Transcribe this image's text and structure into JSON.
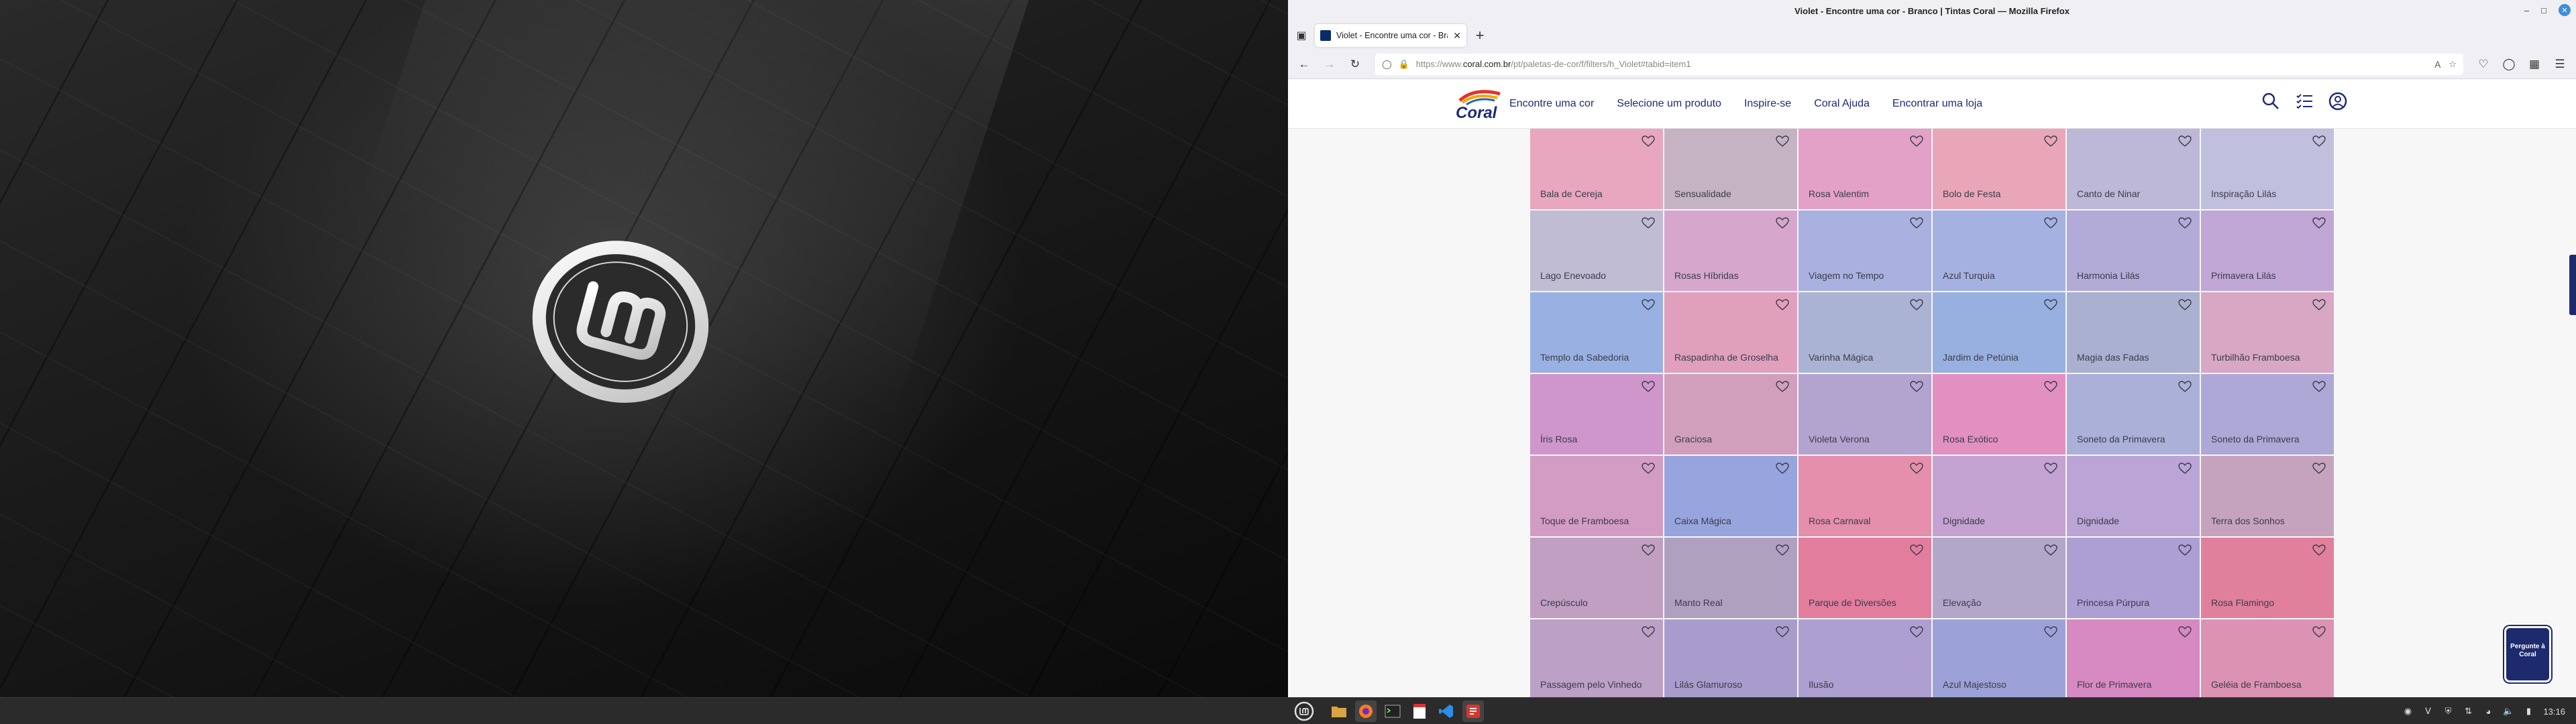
{
  "window": {
    "title": "Violet - Encontre uma cor - Branco | Tintas Coral — Mozilla Firefox"
  },
  "tab": {
    "label": "Violet - Encontre uma cor - Bran"
  },
  "urlbar": {
    "prefix": "https://www.",
    "domain": "coral.com.br",
    "path": "/pt/paletas-de-cor/f/filters/h_Violet#tabid=item1"
  },
  "site": {
    "logo_text": "Coral",
    "nav": [
      "Encontre uma cor",
      "Selecione um produto",
      "Inspire-se",
      "Coral Ajuda",
      "Encontrar uma loja"
    ]
  },
  "swatches": [
    {
      "name": "Bala de Cereja",
      "color": "#e8a7bf"
    },
    {
      "name": "Sensualidade",
      "color": "#c5b3c4"
    },
    {
      "name": "Rosa Valentim",
      "color": "#e3a1c7"
    },
    {
      "name": "Bolo de Festa",
      "color": "#eaa6b9"
    },
    {
      "name": "Canto de Ninar",
      "color": "#bdb7d8"
    },
    {
      "name": "Inspiração Lilás",
      "color": "#c1bfde"
    },
    {
      "name": "Lago Enevoado",
      "color": "#c0bcd4"
    },
    {
      "name": "Rosas Híbridas",
      "color": "#d6a6cd"
    },
    {
      "name": "Viagem no Tempo",
      "color": "#a8b1df"
    },
    {
      "name": "Azul Turquia",
      "color": "#a5b2e1"
    },
    {
      "name": "Harmonia Lilás",
      "color": "#b2aad7"
    },
    {
      "name": "Primavera Lilás",
      "color": "#c0a7d5"
    },
    {
      "name": "Templo da Sabedoria",
      "color": "#99b1e2"
    },
    {
      "name": "Raspadinha de Groselha",
      "color": "#e0a0bc"
    },
    {
      "name": "Varinha Mágica",
      "color": "#aab3d3"
    },
    {
      "name": "Jardim de Petúnia",
      "color": "#98b0e0"
    },
    {
      "name": "Magia das Fadas",
      "color": "#aab0d0"
    },
    {
      "name": "Turbilhão Framboesa",
      "color": "#d7a7c4"
    },
    {
      "name": "Íris Rosa",
      "color": "#cf96cb"
    },
    {
      "name": "Graciosa",
      "color": "#d19fbc"
    },
    {
      "name": "Violeta Verona",
      "color": "#b2a3cf"
    },
    {
      "name": "Rosa Exótico",
      "color": "#e290c2"
    },
    {
      "name": "Soneto da Primavera",
      "color": "#aab0d8"
    },
    {
      "name": "Soneto da Primavera",
      "color": "#aea8d6"
    },
    {
      "name": "Toque de Framboesa",
      "color": "#d39cc4"
    },
    {
      "name": "Caixa Mágica",
      "color": "#97a4dd"
    },
    {
      "name": "Rosa Carnaval",
      "color": "#e58fac"
    },
    {
      "name": "Dignidade",
      "color": "#c4a2d1"
    },
    {
      "name": "Dignidade",
      "color": "#bba4d6"
    },
    {
      "name": "Terra dos Sonhos",
      "color": "#c6a3bd"
    },
    {
      "name": "Crepúsculo",
      "color": "#c09fc3"
    },
    {
      "name": "Manto Real",
      "color": "#b0a0c0"
    },
    {
      "name": "Parque de Diversões",
      "color": "#e27d9e"
    },
    {
      "name": "Elevação",
      "color": "#b2a6c9"
    },
    {
      "name": "Princesa Púrpura",
      "color": "#ad9fd3"
    },
    {
      "name": "Rosa Flamingo",
      "color": "#e0809c"
    },
    {
      "name": "Passagem pelo Vinhedo",
      "color": "#bda0c5"
    },
    {
      "name": "Lilás Glamuroso",
      "color": "#a79ccc"
    },
    {
      "name": "Ilusão",
      "color": "#ad9fd0"
    },
    {
      "name": "Azul Majestoso",
      "color": "#9ca2d8"
    },
    {
      "name": "Flor de Primavera",
      "color": "#d789c1"
    },
    {
      "name": "Geléia de Framboesa",
      "color": "#dc92b3"
    }
  ],
  "chat": {
    "label": "Pergunte à Coral"
  },
  "taskbar": {
    "clock": "13:16"
  }
}
